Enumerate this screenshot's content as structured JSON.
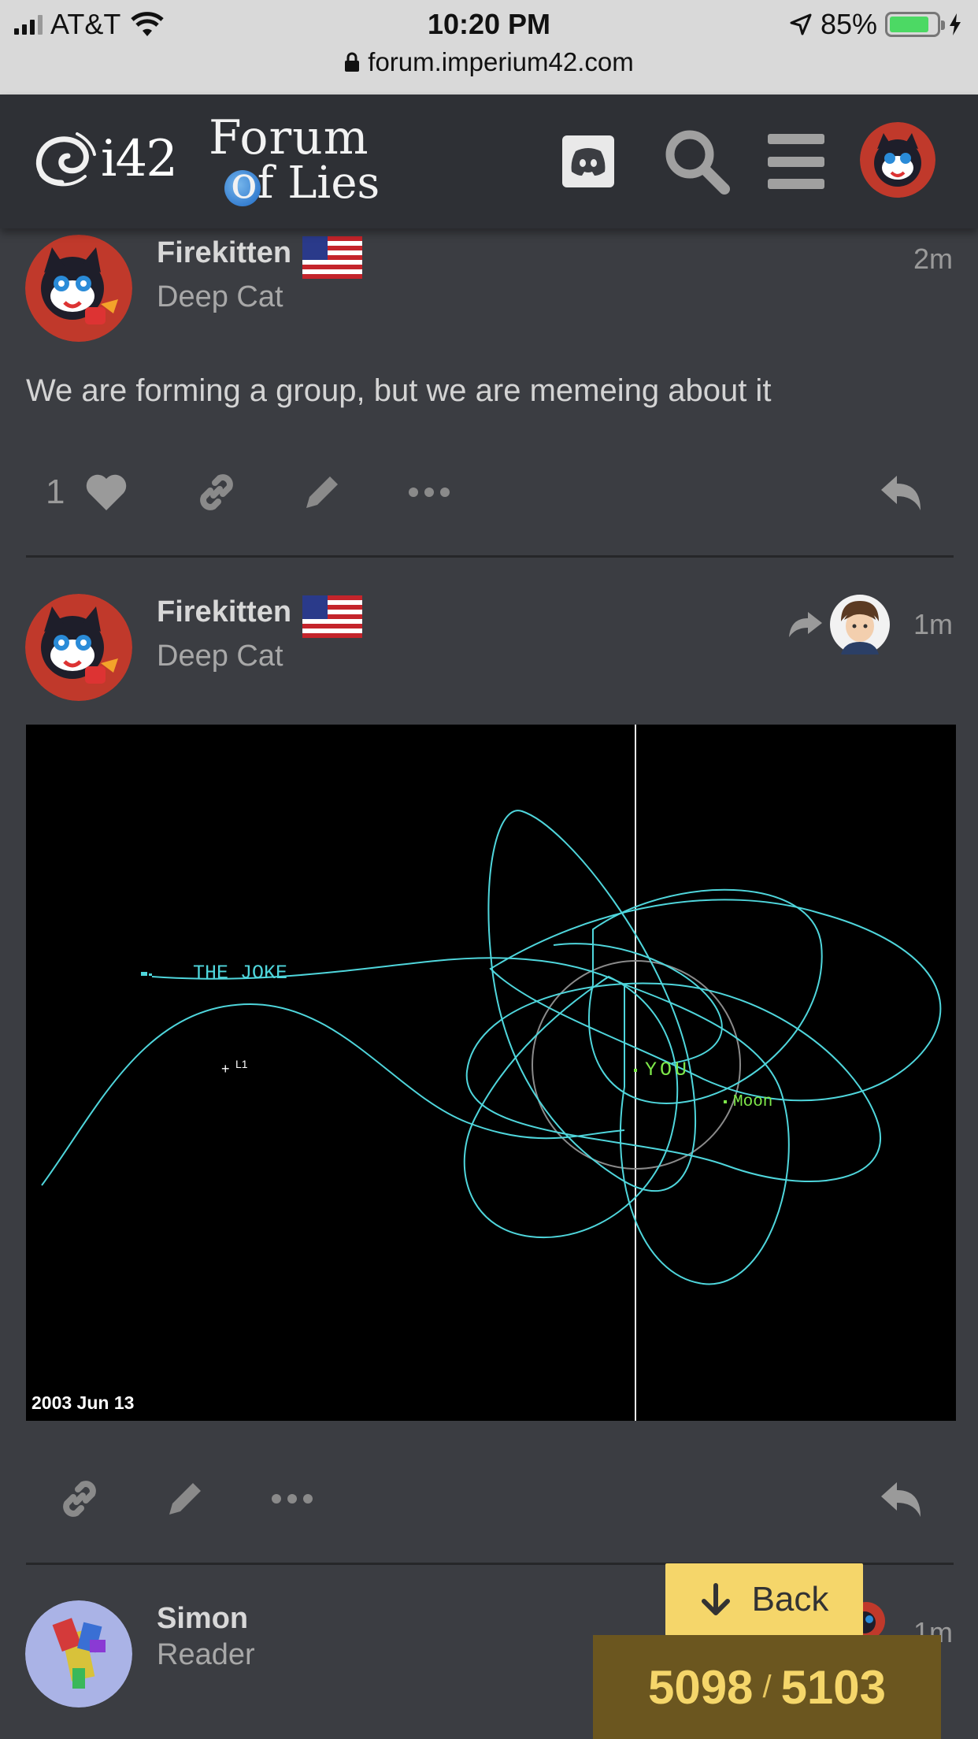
{
  "status_bar": {
    "carrier": "AT&T",
    "time": "10:20 PM",
    "battery_pct": "85%",
    "battery_level": 0.85,
    "url": "forum.imperium42.com"
  },
  "header": {
    "site_logo": "i42",
    "forum_logo_line1": "Forum",
    "forum_logo_line2": "of Lies"
  },
  "colors": {
    "background": "#3b3d42",
    "header": "#2e3035",
    "accent_yellow": "#f5d66a",
    "orbit_cyan": "#4fd6dc",
    "progress_bg": "#6b561f"
  },
  "posts": [
    {
      "username": "Firekitten",
      "user_title": "Deep Cat",
      "time": "2m",
      "text": "We are forming a group, but we are memeing about it",
      "like_count": "1"
    },
    {
      "username": "Firekitten",
      "user_title": "Deep Cat",
      "time": "1m",
      "image": {
        "label_joke": "THE JOKE",
        "label_l1": "L1",
        "label_you": "YOU",
        "label_moon": "Moon",
        "date": "2003 Jun 13"
      }
    },
    {
      "username": "Simon",
      "user_title": "Reader",
      "time": "1m"
    }
  ],
  "navigation": {
    "back_label": "Back",
    "current_post": "5098",
    "total_posts": "5103",
    "separator": "/"
  }
}
